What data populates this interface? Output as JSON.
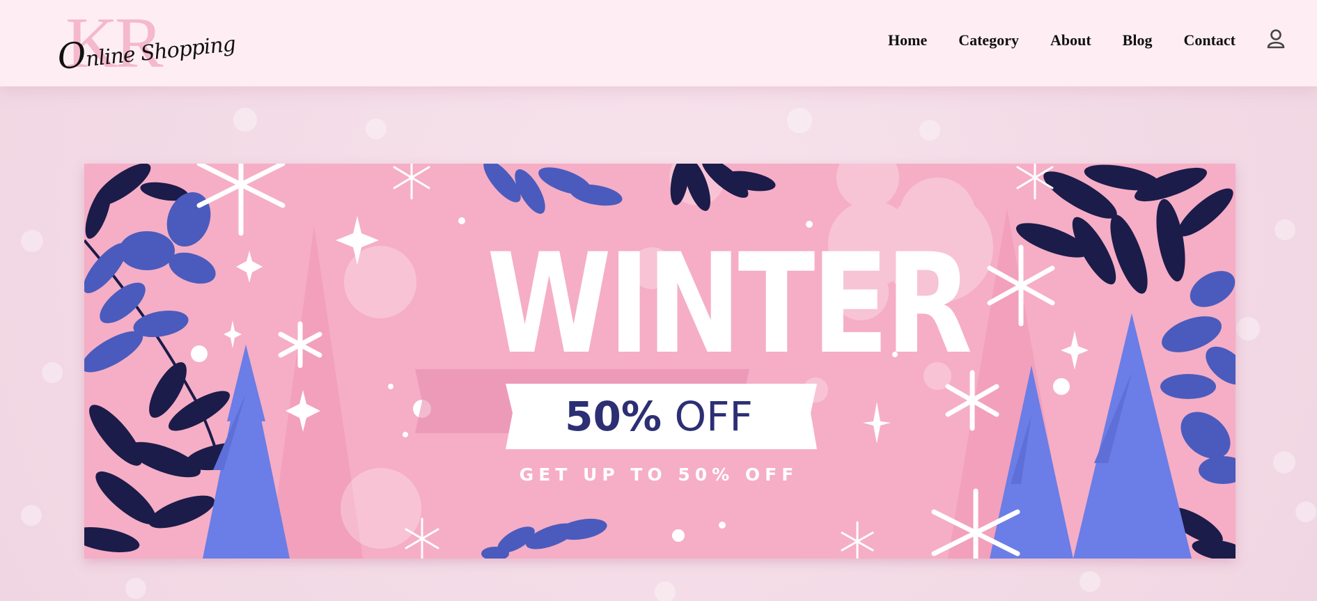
{
  "brand": {
    "logo_letters": "KR",
    "logo_script_initial": "O",
    "logo_script_rest": "nline Shopping"
  },
  "nav": {
    "items": [
      "Home",
      "Category",
      "About",
      "Blog",
      "Contact"
    ],
    "account_icon": "user-icon"
  },
  "banner": {
    "title": "WINTER",
    "discount_value": "50%",
    "discount_label": "OFF",
    "subtitle": "GET UP TO 50% OFF"
  },
  "colors": {
    "header_bg": "#feeef3",
    "page_bg": "#f3dbe6",
    "banner_bg": "#f5aec5",
    "navy_leaf": "#1b1c4a",
    "blue_leaf": "#4a5bbd",
    "tree_blue": "#6b7de6",
    "ribbon_text": "#2c2f74"
  }
}
